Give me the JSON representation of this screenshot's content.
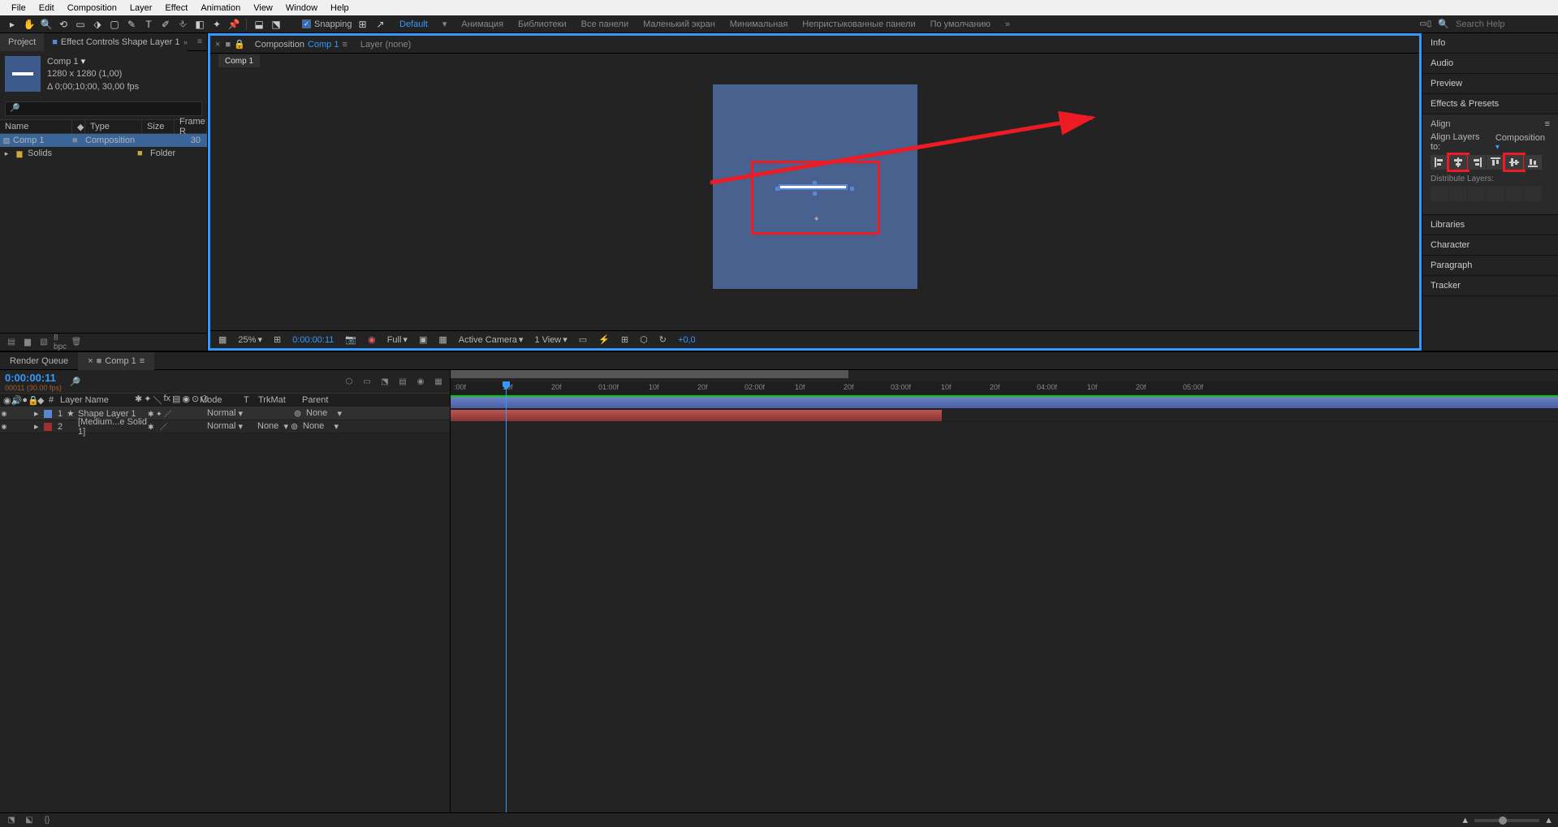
{
  "menu": {
    "items": [
      "File",
      "Edit",
      "Composition",
      "Layer",
      "Effect",
      "Animation",
      "View",
      "Window",
      "Help"
    ]
  },
  "toolbar": {
    "snapping": "Snapping",
    "workspaces": [
      "Default",
      "Анимация",
      "Библиотеки",
      "Все панели",
      "Маленький экран",
      "Минимальная",
      "Непристыкованные панели",
      "По умолчанию"
    ],
    "search_placeholder": "Search Help"
  },
  "project_panel": {
    "tab": "Project",
    "tab2": "Effect Controls Shape Layer 1",
    "comp_name": "Comp 1",
    "comp_dims": "1280 x 1280 (1,00)",
    "comp_dur": "Δ 0;00;10;00, 30,00 fps",
    "headers": {
      "name": "Name",
      "type": "Type",
      "size": "Size",
      "fr": "Frame R"
    },
    "items": [
      {
        "name": "Comp 1",
        "type": "Composition",
        "fr": "30"
      },
      {
        "name": "Solids",
        "type": "Folder",
        "fr": ""
      }
    ],
    "footer_bpc": "8 bpc"
  },
  "viewer": {
    "tab_prefix": "Composition",
    "tab_comp": "Comp 1",
    "tab_layer": "Layer (none)",
    "subtab": "Comp 1",
    "footer": {
      "zoom": "25%",
      "time": "0:00:00:11",
      "res": "Full",
      "camera": "Active Camera",
      "views": "1 View",
      "exp": "+0,0"
    }
  },
  "right_panels": {
    "info": "Info",
    "audio": "Audio",
    "preview": "Preview",
    "effects": "Effects & Presets",
    "align": {
      "title": "Align",
      "layers_to": "Align Layers to:",
      "dd": "Composition",
      "distribute": "Distribute Layers:"
    },
    "libraries": "Libraries",
    "character": "Character",
    "paragraph": "Paragraph",
    "tracker": "Tracker"
  },
  "timeline": {
    "tabs": {
      "rq": "Render Queue",
      "comp": "Comp 1"
    },
    "timecode": "0:00:00:11",
    "frames": "00011 (30.00 fps)",
    "headers": {
      "num": "#",
      "lname": "Layer Name",
      "mode": "Mode",
      "t": "T",
      "trkmat": "TrkMat",
      "parent": "Parent"
    },
    "layers": [
      {
        "num": "1",
        "name": "Shape Layer 1",
        "mode": "Normal",
        "trkmat": "",
        "parent": "None",
        "color": "#5a86d6"
      },
      {
        "num": "2",
        "name": "[Medium...e Solid 1]",
        "mode": "Normal",
        "trkmat": "None",
        "parent": "None",
        "color": "#a03030"
      }
    ],
    "ruler": [
      ":00f",
      "10f",
      "20f",
      "01:00f",
      "10f",
      "20f",
      "02:00f",
      "10f",
      "20f",
      "03:00f",
      "10f",
      "20f",
      "04:00f",
      "10f",
      "20f",
      "05:00f"
    ]
  }
}
